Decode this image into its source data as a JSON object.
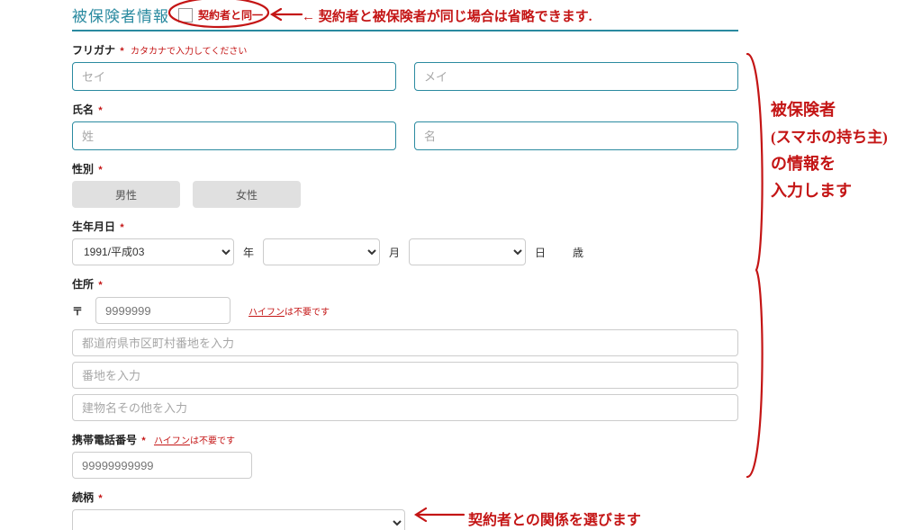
{
  "header": {
    "title": "被保険者情報",
    "same_as_label": "契約者と同一"
  },
  "furigana": {
    "label": "フリガナ",
    "hint": "カタカナで入力してください",
    "sei_placeholder": "セイ",
    "mei_placeholder": "メイ"
  },
  "name": {
    "label": "氏名",
    "sei_placeholder": "姓",
    "mei_placeholder": "名"
  },
  "gender": {
    "label": "性別",
    "male": "男性",
    "female": "女性"
  },
  "dob": {
    "label": "生年月日",
    "year_value": "1991/平成03",
    "year_unit": "年",
    "month_unit": "月",
    "day_unit": "日",
    "age_unit": "歳"
  },
  "address": {
    "label": "住所",
    "postal_mark": "〒",
    "postal_placeholder": "9999999",
    "hyphen_label": "ハイフン",
    "hyphen_note": "は不要です",
    "line1_placeholder": "都道府県市区町村番地を入力",
    "line2_placeholder": "番地を入力",
    "line3_placeholder": "建物名その他を入力"
  },
  "phone": {
    "label": "携帯電話番号",
    "hyphen_label": "ハイフン",
    "hyphen_note": "は不要です",
    "placeholder": "99999999999"
  },
  "relation": {
    "label": "続柄"
  },
  "annotations": {
    "top": "← 契約者と被保険者が同じ場合は省略できます.",
    "right1": "被保険者",
    "right2": "(スマホの持ち主)",
    "right3": "の情報を",
    "right4": "入力します",
    "bottom": "契約者との関係を選びます"
  }
}
